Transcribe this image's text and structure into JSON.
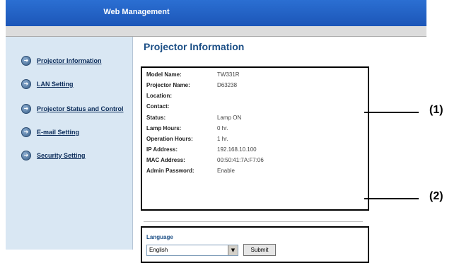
{
  "header": {
    "title": "Web Management"
  },
  "sidebar": {
    "items": [
      {
        "label": "Projector Information"
      },
      {
        "label": "LAN Setting"
      },
      {
        "label": "Projector Status and Control"
      },
      {
        "label": "E-mail Setting"
      },
      {
        "label": "Security Setting"
      }
    ]
  },
  "main": {
    "title": "Projector Information",
    "info": [
      {
        "label": "Model Name:",
        "value": "TW331R"
      },
      {
        "label": "Projector Name:",
        "value": "D63238"
      },
      {
        "label": "Location:",
        "value": ""
      },
      {
        "label": "Contact:",
        "value": ""
      },
      {
        "label": "Status:",
        "value": "Lamp ON"
      },
      {
        "label": "Lamp Hours:",
        "value": "0 hr."
      },
      {
        "label": "Operation Hours:",
        "value": "1 hr."
      },
      {
        "label": "IP Address:",
        "value": "192.168.10.100"
      },
      {
        "label": "MAC Address:",
        "value": "00:50:41:7A:F7:06"
      },
      {
        "label": "Admin Password:",
        "value": "Enable"
      }
    ],
    "language": {
      "label": "Language",
      "selected": "English",
      "submit_label": "Submit"
    }
  },
  "callouts": {
    "one": "(1)",
    "two": "(2)"
  },
  "colors": {
    "header": "#1c56b8",
    "sidebar": "#d9e7f3",
    "title": "#1c4f86"
  },
  "icons": {
    "nav": "arrow-circle-icon",
    "dropdown": "chevron-down-icon"
  }
}
